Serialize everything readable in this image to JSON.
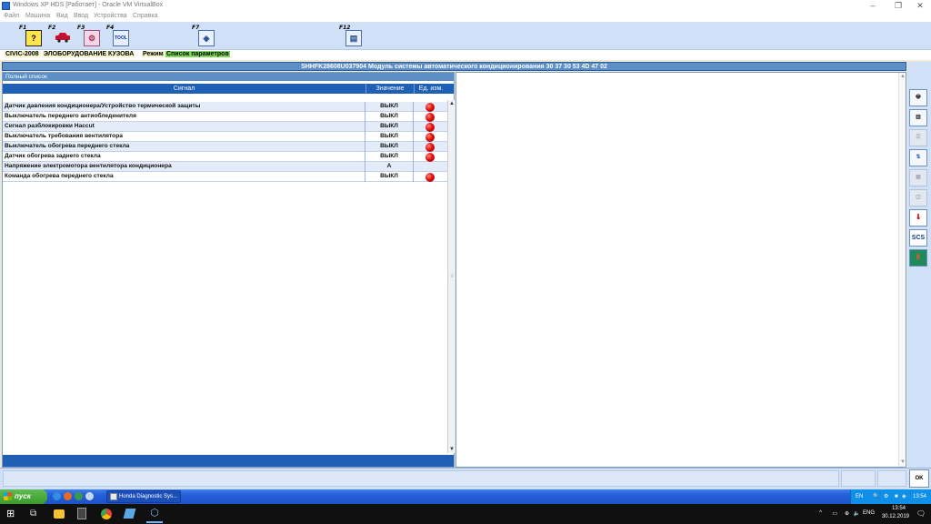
{
  "vbox": {
    "title": "Windows XP HDS [Работает] - Oracle VM VirtualBox",
    "menu": [
      "Файл",
      "Машина",
      "Вид",
      "Ввод",
      "Устройства",
      "Справка"
    ],
    "controls": {
      "minimize": "–",
      "restore": "❐",
      "close": "✕"
    }
  },
  "toolbar": {
    "buttons": [
      {
        "key": "F1",
        "icon": "help-icon",
        "glyph": "?"
      },
      {
        "key": "F2",
        "icon": "car-icon",
        "glyph": "🚗"
      },
      {
        "key": "F3",
        "icon": "diagnostics-icon",
        "glyph": "⚙"
      },
      {
        "key": "F4",
        "icon": "tool-icon",
        "glyph": "TOOL"
      },
      {
        "key": "F7",
        "icon": "data-recorder-icon",
        "glyph": "◈"
      },
      {
        "key": "F12",
        "icon": "printer-icon",
        "glyph": "▤"
      }
    ]
  },
  "info": {
    "vehicle": "CIVIC-2008",
    "system": "ЭЛОБОРУДОВАНИЕ КУЗОВА",
    "mode_label": "Режим",
    "mode_value": "Список параметров"
  },
  "module_header": "SHHFK28608U037904  Модуль системы автоматического кондиционирования  30 37 30 53 4D 47 02",
  "list": {
    "title": "Полный список",
    "columns": {
      "signal": "Сигнал",
      "value": "Значение",
      "unit": "Ед. изм."
    },
    "rows": [
      {
        "signal": "Датчик давления кондиционера/Устройство термической защиты",
        "value": "ВЫКЛ",
        "led": true
      },
      {
        "signal": "Выключатель переднего антиобледенителя",
        "value": "ВЫКЛ",
        "led": true
      },
      {
        "signal": "Сигнал разблокировки Насcut",
        "value": "ВЫКЛ",
        "led": true
      },
      {
        "signal": "Выключатель требования вентилятора",
        "value": "ВЫКЛ",
        "led": true
      },
      {
        "signal": "Выключатель обогрева переднего стекла",
        "value": "ВЫКЛ",
        "led": true
      },
      {
        "signal": "Датчик обогрева заднего стекла",
        "value": "ВЫКЛ",
        "led": true
      },
      {
        "signal": "Напряжение электромотора вентилятора кондиционера",
        "value": "А",
        "led": false
      },
      {
        "signal": "Команда обогрева переднего стекла",
        "value": "ВЫКЛ",
        "led": true
      }
    ]
  },
  "side_toolbar": {
    "buttons": [
      {
        "name": "print-button",
        "icon": "printer-icon",
        "glyph": "🖶",
        "enabled": true
      },
      {
        "name": "graph-button",
        "icon": "graph-icon",
        "glyph": "▥",
        "enabled": true
      },
      {
        "name": "list-button",
        "icon": "list-icon",
        "glyph": "☰",
        "enabled": false
      },
      {
        "name": "select-button",
        "icon": "select-icon",
        "glyph": "⇅",
        "enabled": true
      },
      {
        "name": "grid-button",
        "icon": "grid-icon",
        "glyph": "▦",
        "enabled": false
      },
      {
        "name": "chart-button",
        "icon": "chart-icon",
        "glyph": "◫",
        "enabled": false
      },
      {
        "name": "temperature-button",
        "icon": "thermometer-icon",
        "glyph": "🌡",
        "enabled": true
      },
      {
        "name": "scs-button",
        "icon": "scs-icon",
        "glyph": "SCS",
        "enabled": true
      },
      {
        "name": "exit-button",
        "icon": "exit-door-icon",
        "glyph": "🚪",
        "enabled": true
      }
    ]
  },
  "status": {
    "connection": "OK"
  },
  "xp_taskbar": {
    "start_label": "пуск",
    "task_label": "Honda Diagnostic Sys...",
    "language": "EN",
    "time": "13:54"
  },
  "host_taskbar": {
    "language": "ENG",
    "time": "13:54",
    "date": "30.12.2019"
  },
  "colors": {
    "accent": "#1f5fb4",
    "header_bar": "#5b8fc5",
    "mode_highlight": "#7ed957",
    "led_off": "#e01010"
  }
}
